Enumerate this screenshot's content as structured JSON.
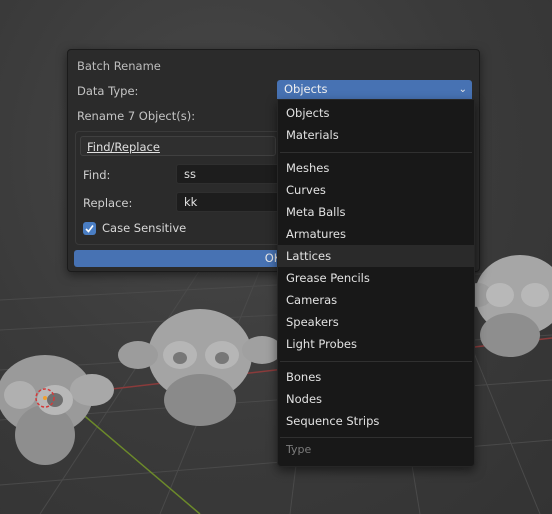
{
  "dialog": {
    "title": "Batch Rename",
    "data_type_label": "Data Type:",
    "rename_label": "Rename 7 Object(s):",
    "method": "Find/Replace",
    "find_label": "Find:",
    "find_value": "ss",
    "replace_label": "Replace:",
    "replace_value": "kk",
    "case_sensitive_label": "Case Sensitive",
    "case_sensitive_checked": true,
    "ok_label": "OK"
  },
  "dropdown": {
    "selected": "Objects",
    "groups": [
      [
        "Objects",
        "Materials"
      ],
      [
        "Meshes",
        "Curves",
        "Meta Balls",
        "Armatures",
        "Lattices",
        "Grease Pencils",
        "Cameras",
        "Speakers",
        "Light Probes"
      ],
      [
        "Bones",
        "Nodes",
        "Sequence Strips"
      ]
    ],
    "hovered": "Lattices",
    "footer": "Type"
  },
  "colors": {
    "accent": "#4772b3",
    "checkbox": "#4a7ec4",
    "panel_bg": "#2b2b2b",
    "menu_bg": "#181818"
  }
}
